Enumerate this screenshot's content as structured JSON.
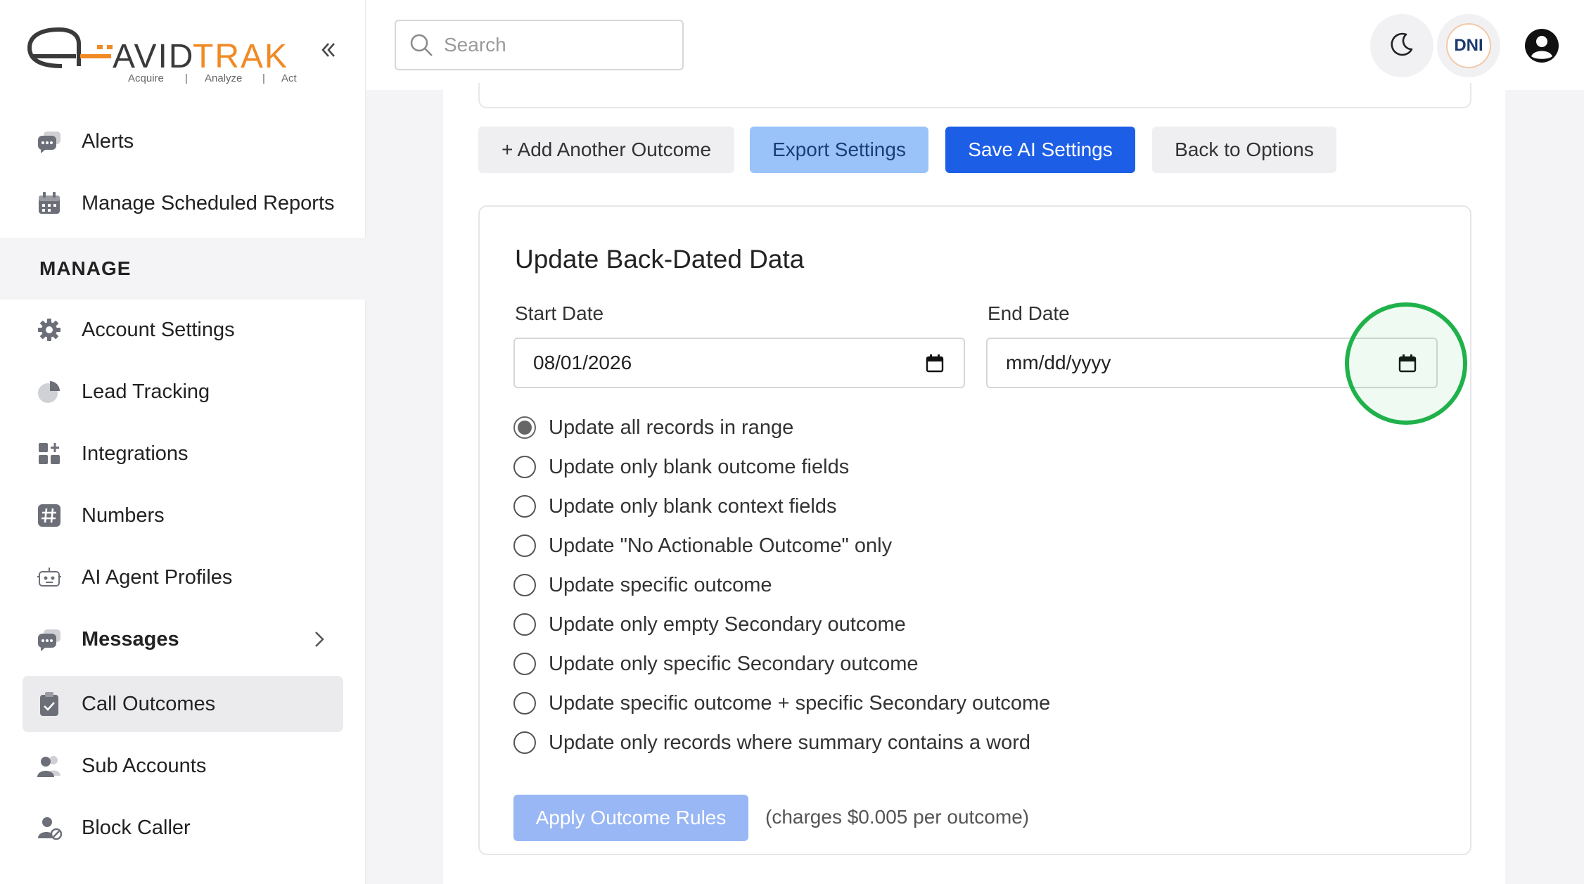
{
  "brand": {
    "name": "AVIDTRAK",
    "tagline": [
      "Acquire",
      "Analyze",
      "Act"
    ],
    "colors": {
      "dark": "#333333",
      "orange": "#f08a24"
    }
  },
  "sidebar": {
    "items_top": [
      {
        "label": "Alerts",
        "icon": "chat-bubble-icon"
      },
      {
        "label": "Manage Scheduled Reports",
        "icon": "calendar-icon"
      }
    ],
    "section": "MANAGE",
    "items": [
      {
        "label": "Account Settings",
        "icon": "gear-icon"
      },
      {
        "label": "Lead Tracking",
        "icon": "pie-chart-icon"
      },
      {
        "label": "Integrations",
        "icon": "grid-plus-icon"
      },
      {
        "label": "Numbers",
        "icon": "hash-icon"
      },
      {
        "label": "AI Agent Profiles",
        "icon": "robot-icon"
      },
      {
        "label": "Messages",
        "icon": "chat-bubble-icon",
        "expandable": true
      },
      {
        "label": "Call Outcomes",
        "icon": "clipboard-icon",
        "active": true
      },
      {
        "label": "Sub Accounts",
        "icon": "users-icon"
      },
      {
        "label": "Block Caller",
        "icon": "user-block-icon"
      }
    ]
  },
  "topbar": {
    "search_placeholder": "Search",
    "dni_label": "DNI"
  },
  "actions": {
    "add_outcome": "+ Add Another Outcome",
    "export": "Export Settings",
    "save": "Save AI Settings",
    "back": "Back to Options"
  },
  "backdated": {
    "title": "Update Back-Dated Data",
    "start_label": "Start Date",
    "start_value": "08/01/2026",
    "end_label": "End Date",
    "end_value": "mm/dd/yyyy",
    "options": [
      {
        "label": "Update all records in range",
        "checked": true
      },
      {
        "label": "Update only blank outcome fields",
        "checked": false
      },
      {
        "label": "Update only blank context fields",
        "checked": false
      },
      {
        "label": "Update \"No Actionable Outcome\" only",
        "checked": false
      },
      {
        "label": "Update specific outcome",
        "checked": false
      },
      {
        "label": "Update only empty Secondary outcome",
        "checked": false
      },
      {
        "label": "Update only specific Secondary outcome",
        "checked": false
      },
      {
        "label": "Update specific outcome + specific Secondary outcome",
        "checked": false
      },
      {
        "label": "Update only records where summary contains a word",
        "checked": false
      }
    ],
    "apply_label": "Apply Outcome Rules",
    "charges_note": "(charges $0.005 per outcome)"
  }
}
